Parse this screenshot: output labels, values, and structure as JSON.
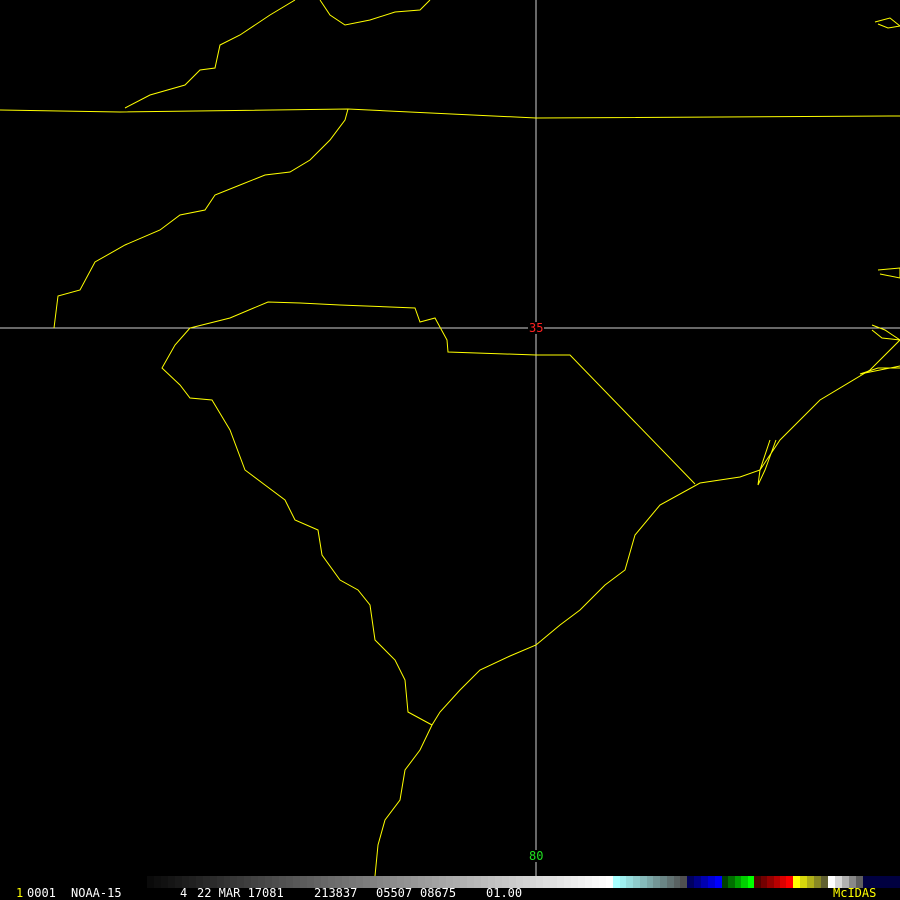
{
  "map": {
    "grid_labels": {
      "latitude": "35",
      "longitude": "80"
    },
    "colors": {
      "boundaries": "#ffff00",
      "grid": "#d0d0d0",
      "lat_label": "#ff2020",
      "lon_label": "#20e020",
      "brand": "#ffff00"
    }
  },
  "status_bar": {
    "frame_number": "1",
    "image_id": "0001",
    "satellite": "NOAA-15",
    "band": "4",
    "date": "22 MAR 17081",
    "time": "213837",
    "line": "05507",
    "element": "08675",
    "resolution": "01.00",
    "brand": "McIDAS"
  },
  "colorbar": {
    "segments": [
      {
        "from": "#0a0a0a",
        "to": "#ffffff",
        "weight": 466
      },
      {
        "from": "#a8ffff",
        "to": "#505050",
        "weight": 74
      },
      {
        "from": "#000060",
        "to": "#0000ff",
        "weight": 35
      },
      {
        "from": "#004000",
        "to": "#00ff00",
        "weight": 32
      },
      {
        "from": "#500000",
        "to": "#ff0000",
        "weight": 39
      },
      {
        "from": "#ffff00",
        "to": "#606030",
        "weight": 35
      },
      {
        "from": "#ffffff",
        "to": "#606060",
        "weight": 35
      },
      {
        "from": "#000040",
        "to": "#000040",
        "weight": 37
      }
    ]
  }
}
